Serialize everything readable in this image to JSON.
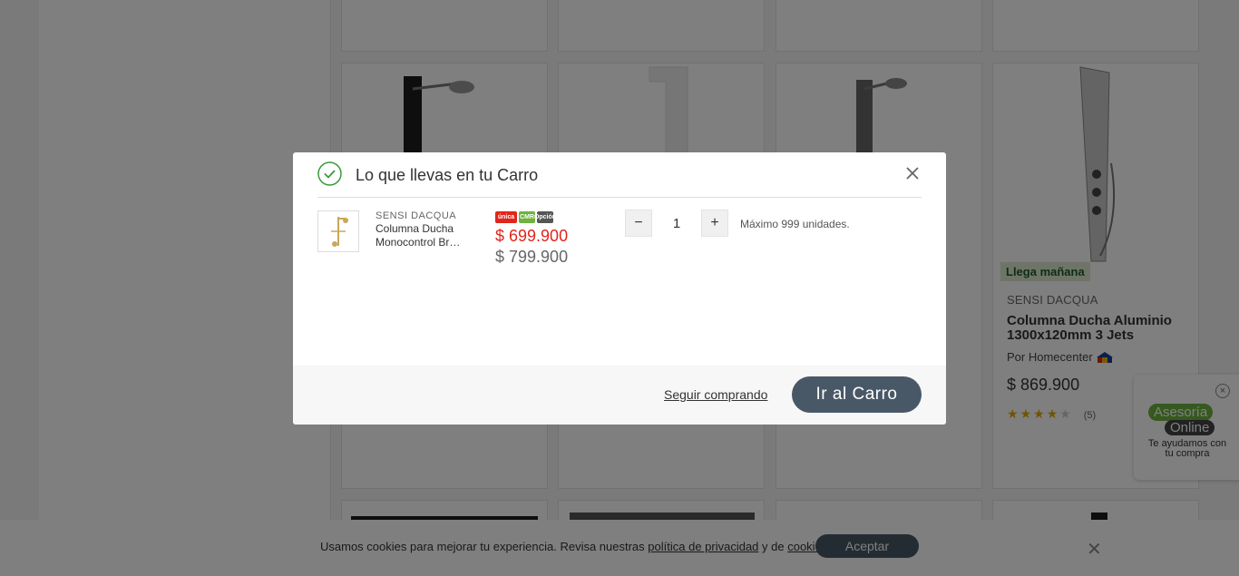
{
  "background": {
    "products": [
      {
        "badge": "Llega mañana",
        "brand": "SENSI DACQUA",
        "name": "Columna Ducha Aluminio 1300x120mm 3 Jets",
        "seller": "Por Homecenter",
        "price": "$ 869.900",
        "rating": 4,
        "rating_count": "(5)"
      }
    ],
    "partial_name_suffix": "ets"
  },
  "chat": {
    "line1": "Asesoría",
    "line2": "Online",
    "subtitle": "Te ayudamos con tu compra",
    "close_icon": "×"
  },
  "cookie_bar": {
    "text_before": "Usamos cookies para mejorar tu experiencia. Revisa nuestras ",
    "privacy_link": "política de privacidad",
    "text_middle": " y de ",
    "cookies_link": "cookies",
    "text_after": ".",
    "accept_label": "Aceptar",
    "close_icon": "✕"
  },
  "modal": {
    "title": "Lo que llevas en tu Carro",
    "close_icon": "close",
    "item": {
      "brand": "SENSI DACQUA",
      "name_line1": "Columna Ducha",
      "name_line2": "Monocontrol Bronce",
      "payment_badges": [
        "única",
        "CMR",
        "Opción"
      ],
      "sale_price": "$ 699.900",
      "normal_price": "$ 799.900",
      "quantity": "1",
      "minus_label": "−",
      "plus_label": "+",
      "max_note": "Máximo 999 unidades."
    },
    "continue_label": "Seguir comprando",
    "cart_button_label": "Ir al Carro"
  }
}
